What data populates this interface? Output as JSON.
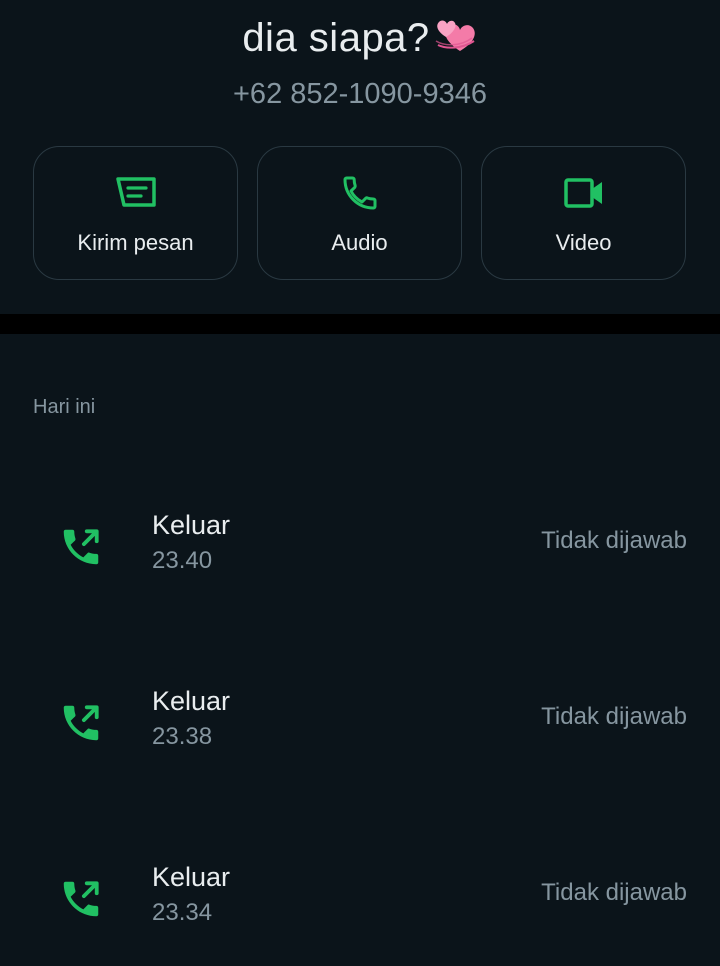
{
  "contact": {
    "name": "dia siapa?",
    "name_emoji": "two-hearts-emoji",
    "phone": "+62 852-1090-9346"
  },
  "actions": [
    {
      "label": "Kirim pesan",
      "icon": "message-icon"
    },
    {
      "label": "Audio",
      "icon": "phone-icon"
    },
    {
      "label": "Video",
      "icon": "video-icon"
    }
  ],
  "history": {
    "section_title": "Hari ini",
    "calls": [
      {
        "direction": "Keluar",
        "time": "23.40",
        "status": "Tidak dijawab",
        "icon": "outgoing-call-icon"
      },
      {
        "direction": "Keluar",
        "time": "23.38",
        "status": "Tidak dijawab",
        "icon": "outgoing-call-icon"
      },
      {
        "direction": "Keluar",
        "time": "23.34",
        "status": "Tidak dijawab",
        "icon": "outgoing-call-icon"
      }
    ]
  },
  "colors": {
    "background": "#0b141a",
    "accent_green": "#21c063",
    "text_primary": "#e9edef",
    "text_secondary": "#8696a0",
    "border": "#2a3942",
    "heart_pink": "#f47ba8"
  }
}
